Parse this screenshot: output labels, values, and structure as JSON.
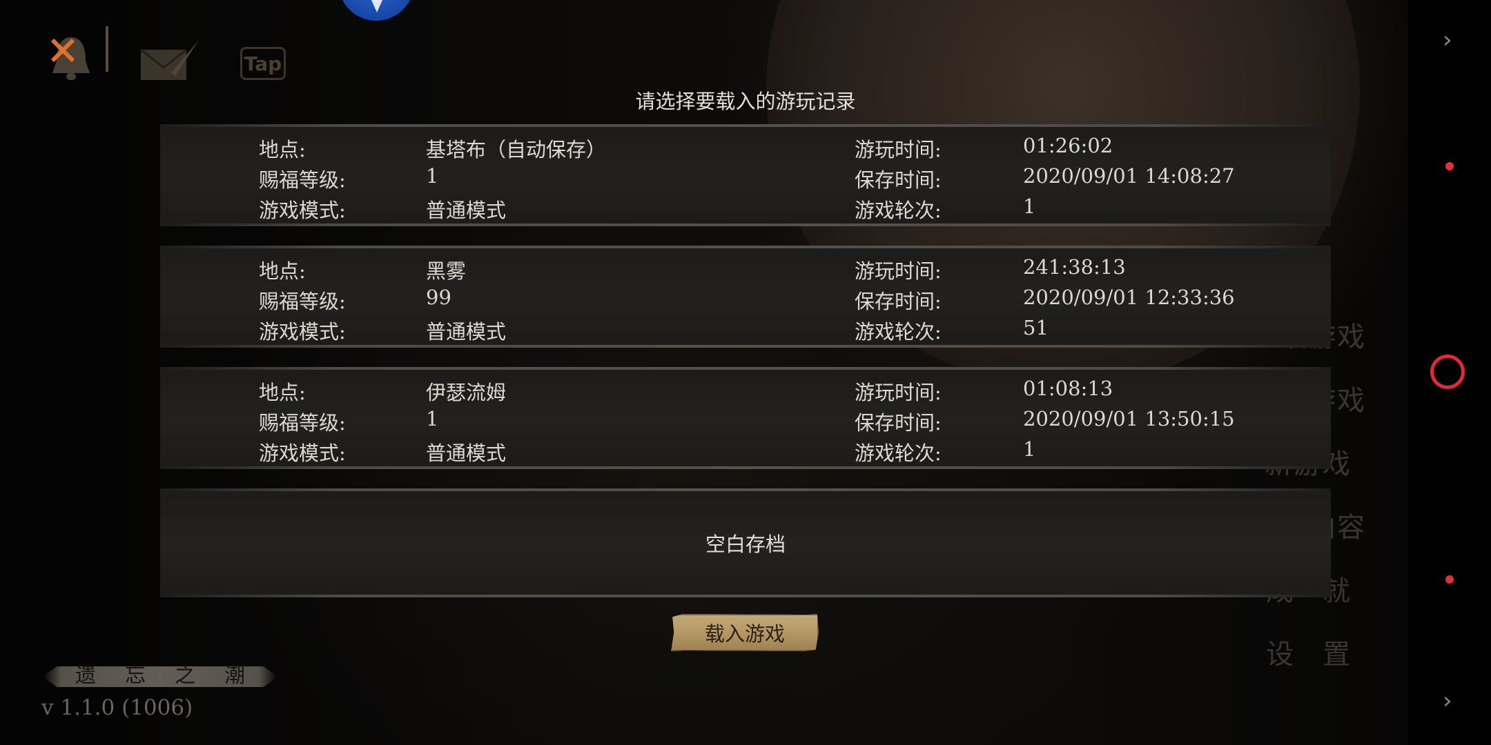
{
  "dialog": {
    "title": "请选择要载入的游玩记录",
    "labels": {
      "location": "地点:",
      "blessing_level": "赐福等级:",
      "game_mode": "游戏模式:",
      "play_time": "游玩时间:",
      "save_time": "保存时间:",
      "game_round": "游戏轮次:"
    },
    "slots": [
      {
        "location": "基塔布（自动保存）",
        "blessing_level": "1",
        "game_mode": "普通模式",
        "play_time": "01:26:02",
        "save_time": "2020/09/01 14:08:27",
        "game_round": "1"
      },
      {
        "location": "黑雾",
        "blessing_level": "99",
        "game_mode": "普通模式",
        "play_time": "241:38:13",
        "save_time": "2020/09/01 12:33:36",
        "game_round": "51"
      },
      {
        "location": "伊瑟流姆",
        "blessing_level": "1",
        "game_mode": "普通模式",
        "play_time": "01:08:13",
        "save_time": "2020/09/01 13:50:15",
        "game_round": "1"
      }
    ],
    "empty_slot_label": "空白存档",
    "load_button_label": "载入游戏"
  },
  "top_bar": {
    "tap_label": "Tap"
  },
  "main_menu": {
    "items": [
      "继续游戏",
      "载入游戏",
      "新游戏",
      "追加内容",
      "成就",
      "设置"
    ]
  },
  "logo_text": "遗忘之潮",
  "version": "v 1.1.0 (1006)",
  "system_bar": {
    "chevron_top": "›",
    "chevron_bottom": "›"
  },
  "colors": {
    "accent_gold": "#b39562",
    "record_red": "#e02a36"
  }
}
